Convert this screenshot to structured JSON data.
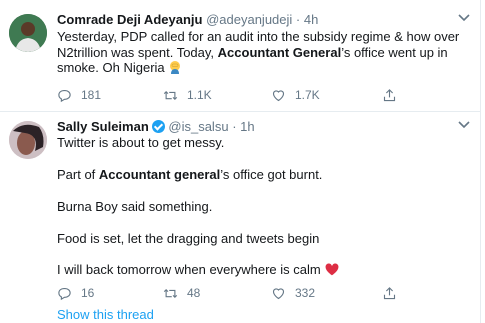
{
  "tweets": [
    {
      "name": "Comrade Deji Adeyanju",
      "handle": "@adeyanjudeji",
      "sep": "·",
      "time": "4h",
      "text_parts": [
        "Yesterday, PDP called for an audit into the subsidy regime & how over N2trillion was spent. Today, ",
        "Accountant General",
        "’s office went up in smoke. Oh Nigeria"
      ],
      "emoji": "face-palm-emoji",
      "stats": {
        "replies": "181",
        "retweets": "1.1K",
        "likes": "1.7K"
      }
    },
    {
      "name": "Sally Suleiman",
      "handle": "@is_salsu",
      "sep": "·",
      "time": "1h",
      "line1": "Twitter is about to get messy.",
      "line2_parts": [
        "Part of ",
        "Accountant general",
        "’s office got burnt."
      ],
      "line3": "Burna Boy said something.",
      "line4": "Food is set, let the dragging and tweets begin",
      "line5": "I will back tomorrow when everywhere is calm",
      "emoji": "red-heart-emoji",
      "stats": {
        "replies": "16",
        "retweets": "48",
        "likes": "332"
      },
      "show_thread": "Show this thread"
    }
  ],
  "colors": {
    "accent": "#1da1f2",
    "muted": "#657786",
    "text": "#14171a",
    "heart": "#e0245e"
  },
  "icons": [
    "reply-icon",
    "retweet-icon",
    "like-icon",
    "share-icon",
    "caret-down-icon",
    "verified-badge-icon"
  ]
}
